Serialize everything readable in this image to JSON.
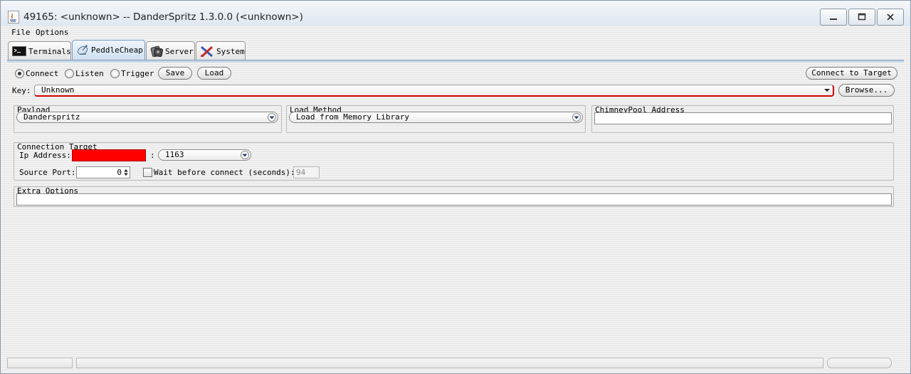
{
  "window": {
    "title": "49165: <unknown> -- DanderSpritz 1.3.0.0 (<unknown>)",
    "controls": [
      "minimize-icon",
      "maximize-icon",
      "close-icon"
    ]
  },
  "menu": {
    "file": "File",
    "options": "Options"
  },
  "tabs": [
    {
      "label": "Terminals",
      "icon": "terminal-icon"
    },
    {
      "label": "PeddleCheap",
      "icon": "satellite-dish-icon",
      "active": true
    },
    {
      "label": "Server",
      "icon": "server-icon"
    },
    {
      "label": "System",
      "icon": "tools-icon"
    }
  ],
  "mode": {
    "connect_label": "Connect",
    "listen_label": "Listen",
    "trigger_label": "Trigger",
    "selected": "Connect",
    "save_label": "Save",
    "load_label": "Load",
    "connect_target_label": "Connect to Target"
  },
  "key": {
    "label": "Key:",
    "value": "Unknown",
    "browse_label": "Browse...",
    "error_color": "#d00000"
  },
  "payload": {
    "label": "Payload",
    "value": "Danderspritz"
  },
  "load_method": {
    "label": "Load Method",
    "value": "Load from Memory Library"
  },
  "chimneypool": {
    "label": "ChimneyPool Address",
    "value": ""
  },
  "connection_target": {
    "label": "Connection Target",
    "ip_label": "Ip Address:",
    "ip_value": "",
    "ip_error_color": "#ff0000",
    "port_separator": ":",
    "port_value": "1163",
    "source_port_label": "Source Port:",
    "source_port_value": "0",
    "wait_label": "Wait before connect (seconds):",
    "wait_checked": false,
    "wait_value": "94"
  },
  "extra_options": {
    "label": "Extra Options",
    "value": ""
  }
}
